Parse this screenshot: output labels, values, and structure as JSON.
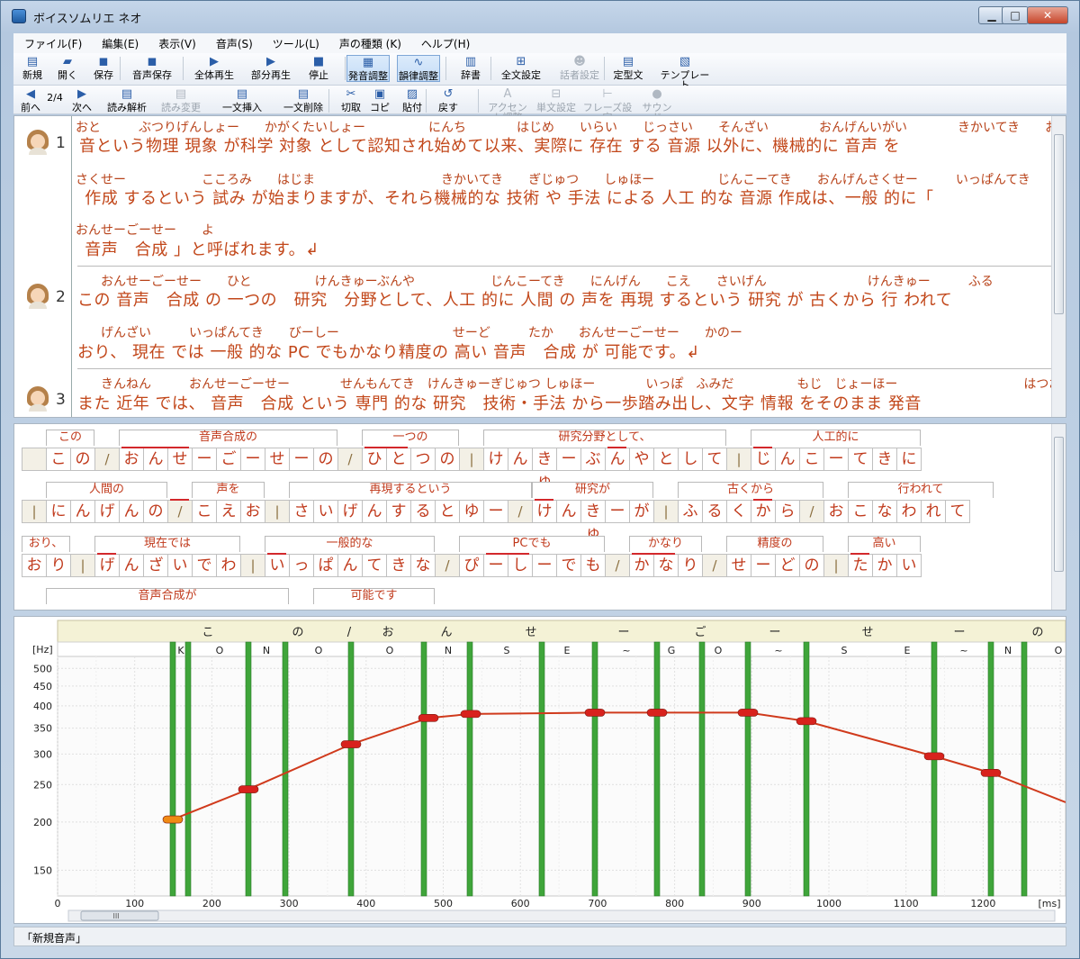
{
  "window": {
    "title": "ボイスソムリエ ネオ",
    "minimize": "▁",
    "maximize": "□",
    "close": "✕"
  },
  "menu": [
    "ファイル(F)",
    "編集(E)",
    "表示(V)",
    "音声(S)",
    "ツール(L)",
    "声の種類 (K)",
    "ヘルプ(H)"
  ],
  "toolbar1": [
    {
      "label": "新規",
      "icon": "new-file-icon",
      "glyph": "▤"
    },
    {
      "label": "開く",
      "icon": "open-folder-icon",
      "glyph": "▰"
    },
    {
      "label": "保存",
      "icon": "save-icon",
      "glyph": "◼"
    },
    {
      "label": "音声保存",
      "icon": "save-voice-icon",
      "glyph": "◼"
    },
    {
      "label": "全体再生",
      "icon": "play-all-icon",
      "glyph": "▶"
    },
    {
      "label": "部分再生",
      "icon": "play-part-icon",
      "glyph": "▶"
    },
    {
      "label": "停止",
      "icon": "stop-icon",
      "glyph": "■"
    },
    {
      "label": "発音調整",
      "icon": "pronunciation-icon",
      "glyph": "▦"
    },
    {
      "label": "韻律調整",
      "icon": "prosody-icon",
      "glyph": "∿"
    },
    {
      "label": "辞書",
      "icon": "dictionary-icon",
      "glyph": "▥"
    },
    {
      "label": "全文設定",
      "icon": "all-settings-icon",
      "glyph": "⊞"
    },
    {
      "label": "話者設定",
      "icon": "speaker-settings-icon",
      "glyph": "☻"
    },
    {
      "label": "定型文",
      "icon": "template-text-icon",
      "glyph": "▤"
    },
    {
      "label": "テンプレート",
      "icon": "template-icon",
      "glyph": "▧"
    }
  ],
  "toolbar2": [
    {
      "label": "前へ",
      "icon": "prev-icon",
      "glyph": "◀"
    },
    {
      "label": "2/4",
      "icon": "",
      "glyph": ""
    },
    {
      "label": "次へ",
      "icon": "next-icon",
      "glyph": "▶"
    },
    {
      "label": "読み解析",
      "icon": "reading-analysis-icon",
      "glyph": "▤"
    },
    {
      "label": "読み変更",
      "icon": "reading-change-icon",
      "glyph": "▤"
    },
    {
      "label": "一文挿入",
      "icon": "insert-sentence-icon",
      "glyph": "▤"
    },
    {
      "label": "一文削除",
      "icon": "delete-sentence-icon",
      "glyph": "▤"
    },
    {
      "label": "切取",
      "icon": "cut-icon",
      "glyph": "✂"
    },
    {
      "label": "コピー",
      "icon": "copy-icon",
      "glyph": "▣"
    },
    {
      "label": "貼付",
      "icon": "paste-icon",
      "glyph": "▨"
    },
    {
      "label": "戻す",
      "icon": "undo-icon",
      "glyph": "↺"
    },
    {
      "label": "アクセント調整",
      "icon": "accent-icon",
      "glyph": "A"
    },
    {
      "label": "単文設定",
      "icon": "sentence-settings-icon",
      "glyph": "⊟"
    },
    {
      "label": "フレーズ設定",
      "icon": "phrase-settings-icon",
      "glyph": "⊢"
    },
    {
      "label": "サウンド",
      "icon": "sound-icon",
      "glyph": "●"
    }
  ],
  "text": {
    "sentences": [
      {
        "num": "1"
      },
      {
        "num": "2"
      },
      {
        "num": "3"
      }
    ],
    "rubies": [
      "おと　　　ぶつりげんしょー　　かがくたいしょー　　　　　にんち　　　　はじめ　　いらい　　じっさい　　そんざい　　　　おんげんいがい　　　　きかいてき　　おんせー",
      "さくせー　　　　　　こころみ　　はじま　　　　　　　　　　きかいてき　　ぎじゅつ　　しゅほー　　　　　じんこーてき　　おんげんさくせー　　　いっぱんてき",
      "おんせーごーせー　　よ",
      "　　おんせーごーせー　　ひと　　　　　けんきゅーぶんや　　　　　　じんこーてき　　にんげん　　こえ　　さいげん　　　　　　　　けんきゅー　　　ふる　　　　　おこな",
      "　　げんざい　　　いっぱんてき　　びーしー　　　　　　　　　せーど　　　たか　　おんせーごーせー　　かのー",
      "　　きんねん　　　おんせーごーせー　　　　せんもんてき　けんきゅーぎじゅつ しゅほー　　　　いっぽ　ふみだ　　　　　もじ　じょーほー　　　　　　　　　　はつおん"
    ],
    "lines": [
      "音という物理 現象 が科学 対象 として認知され始めて以来、実際に 存在 する 音源 以外に、機械的に 音声 を",
      " 作成 するという 試み が始まりますが、それら機械的な 技術 や 手法 による 人工 的な 音源 作成は、一般 的に「",
      " 音声　合成 」と呼ばれます。↲",
      "この 音声　合成 の 一つの　研究　分野として、人工 的に 人間 の 声を 再現 するという 研究 が 古くから 行 われて",
      "おり、 現在 では 一般 的な PC でもかなり精度の 高い 音声　合成 が 可能です。↲",
      "また 近年 では、 音声　合成 という 専門 的な 研究　技術・手法 から一歩踏み出し、文字 情報 をそのまま 発音"
    ]
  },
  "kana": {
    "rows": [
      {
        "phrases": [
          "この",
          "音声合成の",
          "一つの",
          "研究分野として、",
          "人工的に"
        ],
        "moras": [
          "",
          "こ",
          "の",
          "/",
          "お",
          "ん",
          "せ",
          "ー",
          "ご",
          "ー",
          "せ",
          "ー",
          "の",
          "/",
          "ひ",
          "と",
          "つ",
          "の",
          "|",
          "け",
          "ん",
          "きゅ",
          "ー",
          "ぶ",
          "ん",
          "や",
          "と",
          "し",
          "て",
          "|",
          "じ",
          "ん",
          "こ",
          "ー",
          "て",
          "き",
          "に"
        ]
      },
      {
        "phrases": [
          "人間の",
          "声を",
          "再現するという",
          "研究が",
          "古くから",
          "行われて"
        ],
        "moras": [
          "|",
          "に",
          "ん",
          "げ",
          "ん",
          "の",
          "/",
          "こ",
          "え",
          "お",
          "|",
          "さ",
          "い",
          "げ",
          "ん",
          "す",
          "る",
          "と",
          "ゆ",
          "ー",
          "/",
          "け",
          "ん",
          "きゅ",
          "ー",
          "が",
          "|",
          "ふ",
          "る",
          "く",
          "か",
          "ら",
          "/",
          "お",
          "こ",
          "な",
          "わ",
          "れ",
          "て"
        ]
      },
      {
        "phrases": [
          "おり、",
          "現在では",
          "一般的な",
          "PCでも",
          "かなり",
          "精度の",
          "高い"
        ],
        "moras": [
          "お",
          "り",
          "|",
          "げ",
          "ん",
          "ざ",
          "い",
          "で",
          "わ",
          "|",
          "い",
          "っ",
          "ぱ",
          "ん",
          "て",
          "き",
          "な",
          "/",
          "ぴ",
          "ー",
          "し",
          "ー",
          "で",
          "も",
          "/",
          "か",
          "な",
          "り",
          "/",
          "せ",
          "ー",
          "ど",
          "の",
          "|",
          "た",
          "か",
          "い"
        ]
      },
      {
        "phrases": [
          "音声合成が",
          "可能です"
        ],
        "moras": []
      }
    ]
  },
  "pitch": {
    "mora_header": [
      "こ",
      "の",
      "/",
      "お",
      "ん",
      "せ",
      "ー",
      "ご",
      "ー",
      "せ",
      "ー",
      "の"
    ],
    "phonemes": [
      "K",
      "O",
      "N",
      "O",
      "O",
      "N",
      "S",
      "E",
      "~",
      "G",
      "O",
      "~",
      "S",
      "E",
      "~",
      "N",
      "O"
    ],
    "y_unit": "[Hz]",
    "y_ticks": [
      "500",
      "450",
      "400",
      "350",
      "300",
      "250",
      "200",
      "150"
    ],
    "x_ticks": [
      "0",
      "100",
      "200",
      "300",
      "400",
      "500",
      "600",
      "700",
      "800",
      "900",
      "1000",
      "1100",
      "1200"
    ],
    "x_unit": "[ms]",
    "points": [
      {
        "t": 150,
        "hz": 203
      },
      {
        "t": 250,
        "hz": 243
      },
      {
        "t": 380,
        "hz": 318
      },
      {
        "t": 480,
        "hz": 372
      },
      {
        "t": 535,
        "hz": 381
      },
      {
        "t": 700,
        "hz": 384
      },
      {
        "t": 780,
        "hz": 384
      },
      {
        "t": 900,
        "hz": 384
      },
      {
        "t": 970,
        "hz": 365
      },
      {
        "t": 1140,
        "hz": 296
      },
      {
        "t": 1220,
        "hz": 268
      },
      {
        "t": 1300,
        "hz": 225
      }
    ],
    "phoneme_bounds_ms": [
      150,
      170,
      250,
      295,
      380,
      485,
      535,
      630,
      700,
      780,
      805,
      900,
      975,
      1140,
      1210,
      1260
    ],
    "scrollbar_text": "III"
  },
  "status": {
    "text": "「新規音声」"
  }
}
